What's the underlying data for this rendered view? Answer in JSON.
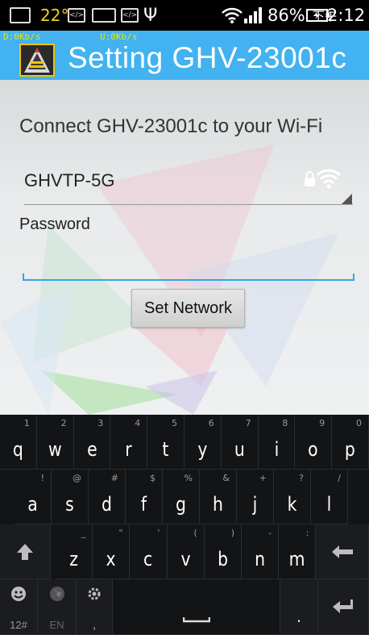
{
  "status_bar": {
    "temperature": "22°",
    "battery": "86%",
    "time_prefix": "下午",
    "time": "2:12",
    "icons": [
      "gallery-icon",
      "code-icon",
      "keyboard-icon",
      "code-icon",
      "usb-icon",
      "wifi-icon",
      "signal-icon",
      "battery-charging-icon"
    ]
  },
  "app": {
    "download_speed": "D:0Kb/s",
    "upload_speed": "U:0Kb/s",
    "title": "Setting GHV-23001c",
    "accent_color": "#42b2f0"
  },
  "form": {
    "connect_label": "Connect GHV-23001c to your Wi-Fi",
    "network_name": "GHVTP-5G",
    "password_label": "Password",
    "password_value": "",
    "button_label": "Set Network"
  },
  "keyboard": {
    "row1": [
      {
        "k": "q",
        "s": "1"
      },
      {
        "k": "w",
        "s": "2"
      },
      {
        "k": "e",
        "s": "3"
      },
      {
        "k": "r",
        "s": "4"
      },
      {
        "k": "t",
        "s": "5"
      },
      {
        "k": "y",
        "s": "6"
      },
      {
        "k": "u",
        "s": "7"
      },
      {
        "k": "i",
        "s": "8"
      },
      {
        "k": "o",
        "s": "9"
      },
      {
        "k": "p",
        "s": "0"
      }
    ],
    "row2": [
      {
        "k": "a",
        "s": "!"
      },
      {
        "k": "s",
        "s": "@"
      },
      {
        "k": "d",
        "s": "#"
      },
      {
        "k": "f",
        "s": "$"
      },
      {
        "k": "g",
        "s": "%"
      },
      {
        "k": "h",
        "s": "&"
      },
      {
        "k": "j",
        "s": "+"
      },
      {
        "k": "k",
        "s": "?"
      },
      {
        "k": "l",
        "s": "/"
      }
    ],
    "row3": [
      {
        "k": "z",
        "s": "_"
      },
      {
        "k": "x",
        "s": "\""
      },
      {
        "k": "c",
        "s": "'"
      },
      {
        "k": "v",
        "s": "("
      },
      {
        "k": "b",
        "s": ")"
      },
      {
        "k": "n",
        "s": "-"
      },
      {
        "k": "m",
        "s": ":"
      }
    ],
    "symbols_label": "12#",
    "language_label": "EN",
    "comma": ",",
    "period": "."
  }
}
